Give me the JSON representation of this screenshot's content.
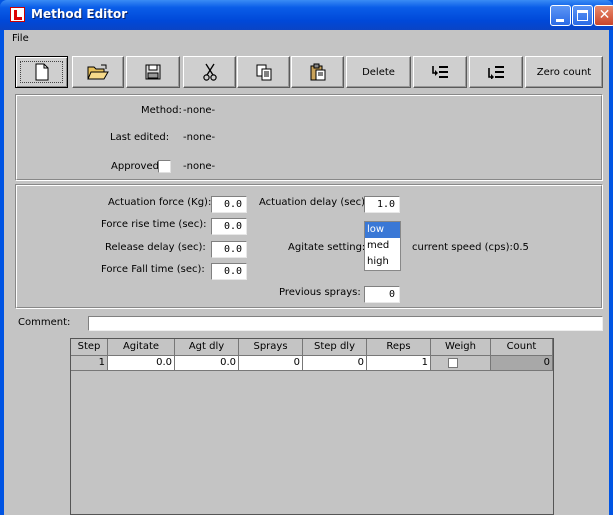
{
  "window": {
    "title": "Method Editor"
  },
  "menu": {
    "file": "File"
  },
  "toolbar": {
    "new_icon": "new-document-icon",
    "open_icon": "open-folder-icon",
    "save_icon": "save-disk-icon",
    "cut_icon": "scissors-icon",
    "copy_icon": "copy-icon",
    "paste_icon": "clipboard-icon",
    "delete_label": "Delete",
    "insert_before_icon": "insert-row-before-icon",
    "insert_after_icon": "insert-row-after-icon",
    "zero_count_label": "Zero count"
  },
  "info": {
    "method_label": "Method:",
    "method_value": "-none-",
    "last_edited_label": "Last edited:",
    "last_edited_value": "-none-",
    "approved_label": "Approved",
    "approved_value": "-none-"
  },
  "params": {
    "actuation_force_label": "Actuation force (Kg):",
    "actuation_force_value": "0.0",
    "force_rise_label": "Force rise time (sec):",
    "force_rise_value": "0.0",
    "release_delay_label": "Release delay (sec):",
    "release_delay_value": "0.0",
    "force_fall_label": "Force Fall time (sec):",
    "force_fall_value": "0.0",
    "actuation_delay_label": "Actuation delay (sec):",
    "actuation_delay_value": "1.0",
    "agitate_label": "Agitate setting:",
    "agitate_options": [
      "low",
      "med",
      "high"
    ],
    "agitate_selected": "low",
    "speed_label": "current speed (cps):",
    "speed_value": "0.5",
    "previous_sprays_label": "Previous sprays:",
    "previous_sprays_value": "0"
  },
  "comment": {
    "label": "Comment:",
    "value": ""
  },
  "table": {
    "columns": [
      "Step",
      "Agitate",
      "Agt dly",
      "Sprays",
      "Step dly",
      "Reps",
      "Weigh",
      "Count"
    ],
    "rows": [
      {
        "step": "1",
        "agitate": "0.0",
        "agt_dly": "0.0",
        "sprays": "0",
        "step_dly": "0",
        "reps": "1",
        "weigh": false,
        "count": "0"
      }
    ]
  }
}
